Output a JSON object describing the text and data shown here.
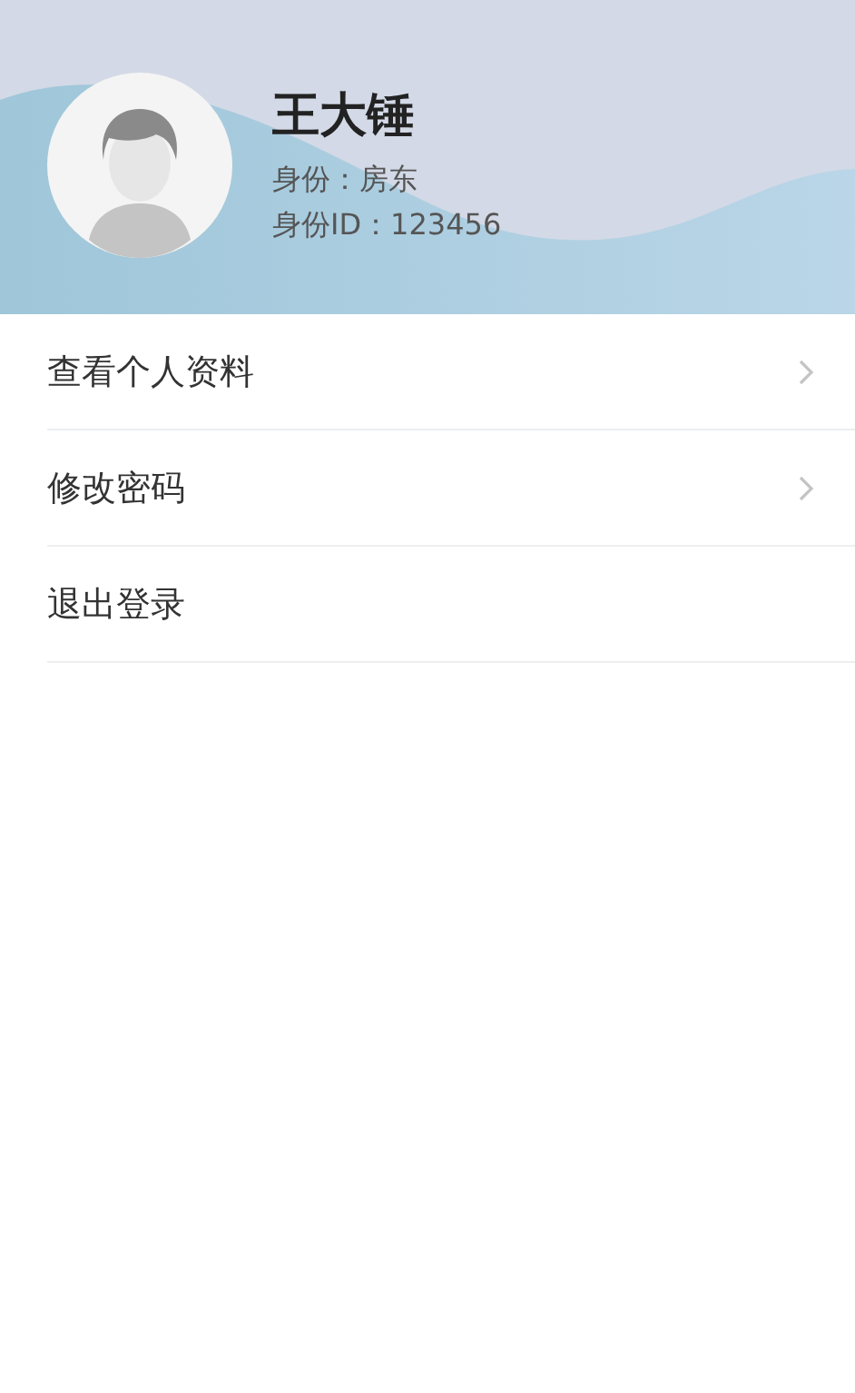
{
  "profile": {
    "name": "王大锤",
    "role": "身份：房东",
    "id_line": "身份ID：123456"
  },
  "menu": [
    {
      "label": "查看个人资料",
      "has_arrow": true
    },
    {
      "label": "修改密码",
      "has_arrow": true
    },
    {
      "label": "退出登录",
      "has_arrow": false
    }
  ]
}
